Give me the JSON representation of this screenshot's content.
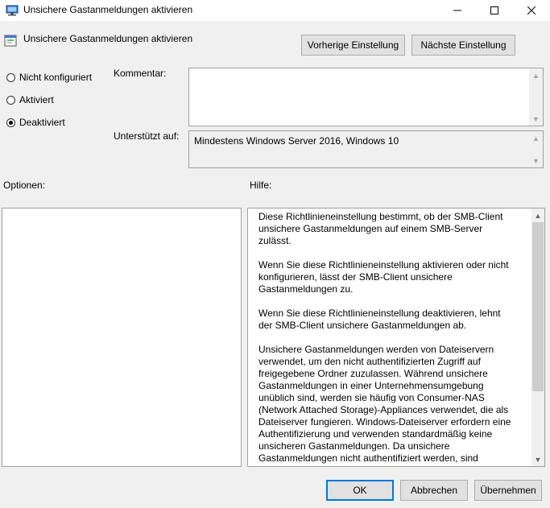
{
  "window": {
    "title": "Unsichere Gastanmeldungen aktivieren",
    "minimize_glyph": "—",
    "maximize_glyph": "☐",
    "close_glyph": "✕"
  },
  "header": {
    "policy_title": "Unsichere Gastanmeldungen aktivieren",
    "prev_label": "Vorherige Einstellung",
    "next_label": "Nächste Einstellung"
  },
  "state": {
    "options": [
      {
        "label": "Nicht konfiguriert",
        "checked": false
      },
      {
        "label": "Aktiviert",
        "checked": false
      },
      {
        "label": "Deaktiviert",
        "checked": true
      }
    ]
  },
  "comment": {
    "label": "Kommentar:",
    "value": ""
  },
  "supported": {
    "label": "Unterstützt auf:",
    "value": "Mindestens Windows Server 2016, Windows 10"
  },
  "options_label": "Optionen:",
  "help": {
    "label": "Hilfe:",
    "paragraphs": [
      "Diese Richtlinieneinstellung bestimmt, ob der SMB-Client unsichere Gastanmeldungen auf einem SMB-Server zulässt.",
      "Wenn Sie diese Richtlinieneinstellung aktivieren oder nicht konfigurieren, lässt der SMB-Client unsichere Gastanmeldungen zu.",
      "Wenn Sie diese Richtlinieneinstellung deaktivieren, lehnt der SMB-Client unsichere Gastanmeldungen ab.",
      "Unsichere Gastanmeldungen werden von Dateiservern verwendet, um den nicht authentifizierten Zugriff auf freigegebene Ordner zuzulassen. Während unsichere Gastanmeldungen in einer Unternehmensumgebung unüblich sind, werden sie häufig von Consumer-NAS (Network Attached Storage)-Appliances verwendet, die als Dateiserver fungieren. Windows-Dateiserver erfordern eine Authentifizierung und verwenden standardmäßig keine unsicheren Gastanmeldungen. Da unsichere Gastanmeldungen nicht authentifiziert werden, sind wichtige Sicherheitsfeatures wie SMB-Signatur und SMB-Verschlüsselung deaktiviert. Folglich haben Clients, die unsichere"
    ]
  },
  "footer": {
    "ok_label": "OK",
    "cancel_label": "Abbrechen",
    "apply_label": "Übernehmen"
  },
  "colors": {
    "accent": "#0078d7",
    "button_face": "#e1e1e1",
    "dialog_bg": "#f0f0f0"
  }
}
